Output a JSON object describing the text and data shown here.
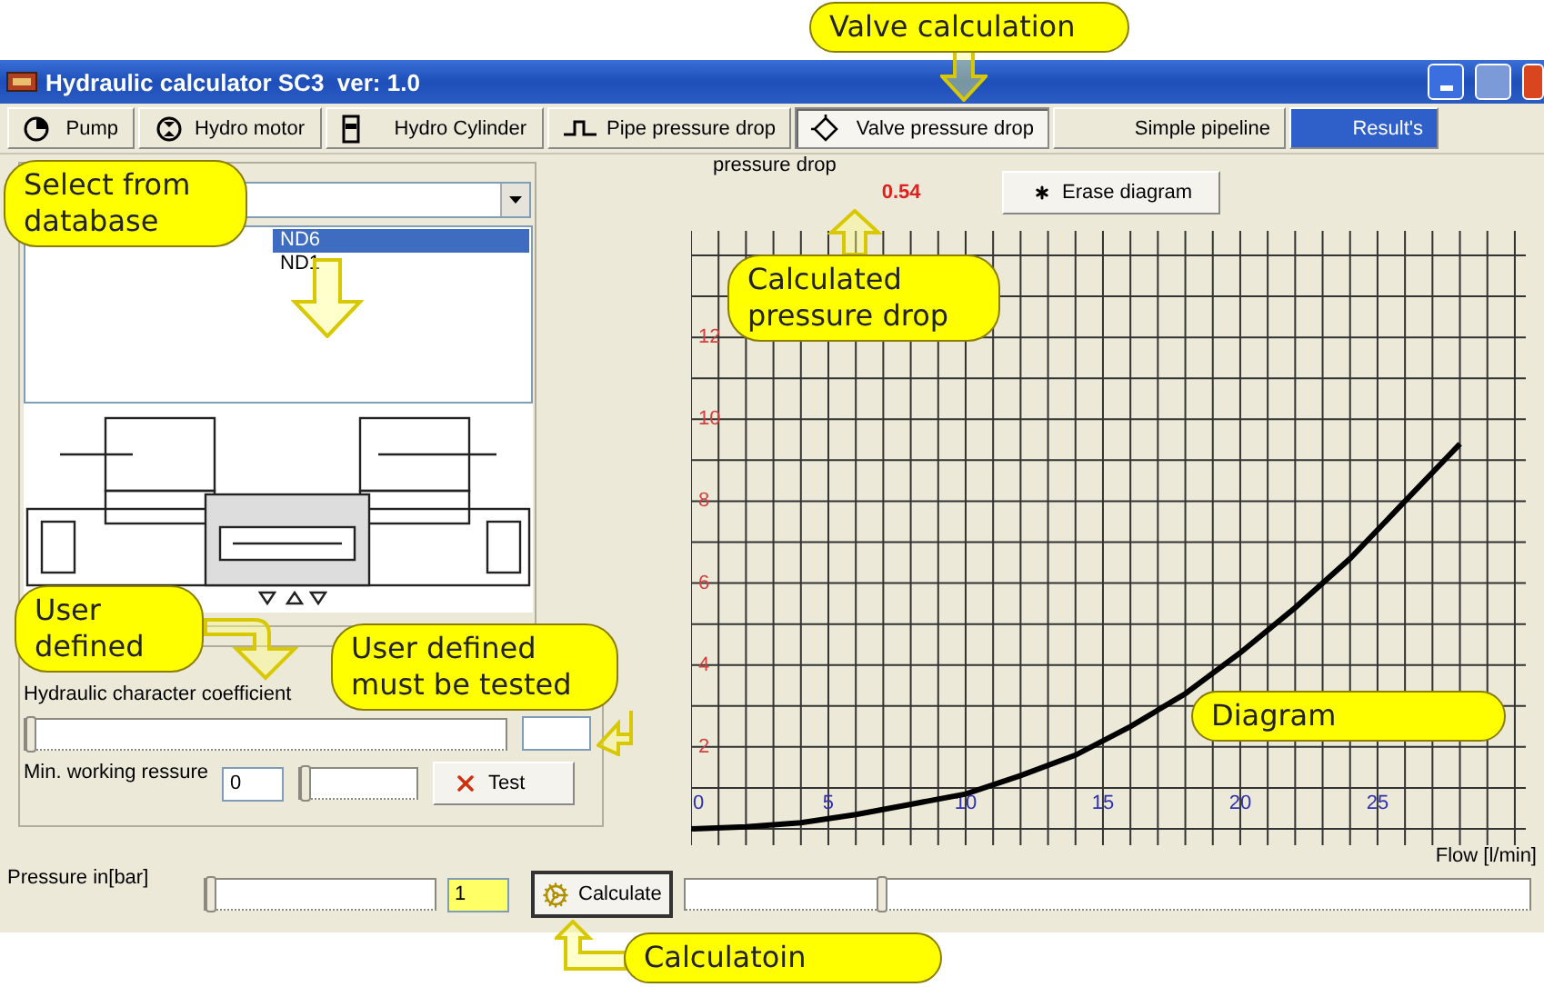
{
  "window": {
    "title": "Hydraulic calculator SC3  ver: 1.0"
  },
  "tabs": [
    {
      "label": "Pump",
      "selected": false,
      "highlighted": false
    },
    {
      "label": "Hydro motor",
      "selected": false,
      "highlighted": false
    },
    {
      "label": "Hydro Cylinder",
      "selected": false,
      "highlighted": false
    },
    {
      "label": "Pipe pressure drop",
      "selected": false,
      "highlighted": false
    },
    {
      "label": "Valve pressure drop",
      "selected": true,
      "highlighted": false
    },
    {
      "label": "Simple pipeline",
      "selected": false,
      "highlighted": false
    },
    {
      "label": "Result's",
      "selected": false,
      "highlighted": true
    }
  ],
  "valve_list": {
    "items": [
      {
        "text": "ND6",
        "selected": true
      },
      {
        "text": "ND1",
        "selected": false
      }
    ]
  },
  "coefficient": {
    "label": "Hydraulic character coefficient",
    "level": 0
  },
  "min_pressure": {
    "label": "Min. working ressure",
    "value": "0",
    "level": 0,
    "test_button": "Test"
  },
  "result": {
    "label": "pressure drop",
    "value": "0.54",
    "erase_button": "Erase diagram"
  },
  "chart_data": {
    "type": "line",
    "xlabel": "Flow [l/min]",
    "x": [
      0,
      2,
      4,
      6,
      8,
      10,
      12,
      14,
      16,
      18,
      20,
      22,
      24,
      26,
      28
    ],
    "series": [
      {
        "color": "#000000",
        "values": [
          0,
          0.05,
          0.15,
          0.35,
          0.6,
          0.85,
          1.3,
          1.8,
          2.5,
          3.3,
          4.3,
          5.4,
          6.6,
          8.0,
          9.4
        ]
      }
    ],
    "xlim": [
      0,
      30.4
    ],
    "ylim": [
      -0.4,
      14.6
    ],
    "grid": true,
    "xticks": [
      0,
      5,
      10,
      15,
      20,
      25
    ],
    "yticks": [
      2,
      4,
      6,
      8,
      10,
      12
    ]
  },
  "pressure": {
    "label": "Pressure in[bar]",
    "level": 0,
    "value": "1"
  },
  "calculate_button": "Calculate",
  "flow_slider": {
    "level": 0.23
  },
  "callouts": [
    {
      "text": "Valve calculation"
    },
    {
      "text": "Select from database"
    },
    {
      "text": "Calculated pressure drop"
    },
    {
      "text": "User defined"
    },
    {
      "text": "User defined must be tested"
    },
    {
      "text": "Diagram"
    },
    {
      "text": "Calculatoin"
    }
  ]
}
